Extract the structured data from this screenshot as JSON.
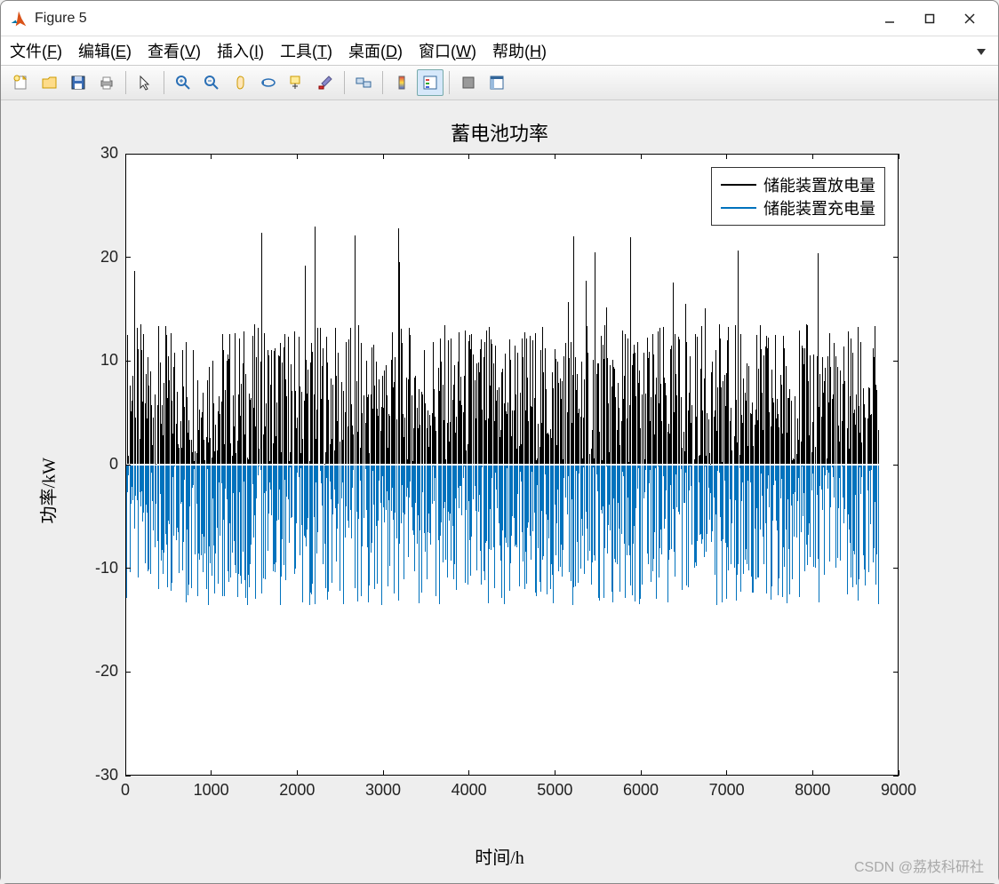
{
  "window": {
    "title": "Figure 5"
  },
  "menu": {
    "file": "文件(F)",
    "edit": "编辑(E)",
    "view": "查看(V)",
    "insert": "插入(I)",
    "tools": "工具(T)",
    "desktop": "桌面(D)",
    "window": "窗口(W)",
    "help": "帮助(H)"
  },
  "chart_data": {
    "type": "bar",
    "title": "蓄电池功率",
    "xlabel": "时间/h",
    "ylabel": "功率/kW",
    "xlim": [
      0,
      9000
    ],
    "ylim": [
      -30,
      30
    ],
    "xticks": [
      0,
      1000,
      2000,
      3000,
      4000,
      5000,
      6000,
      7000,
      8000,
      9000
    ],
    "yticks": [
      -30,
      -20,
      -10,
      0,
      10,
      20,
      30
    ],
    "x_range_data": [
      0,
      8760
    ],
    "series": [
      {
        "name": "储能装置放电量",
        "color": "#000000",
        "typical_range": [
          0,
          13.5
        ],
        "peaks_observed": [
          19,
          20,
          20.5,
          22,
          22.5
        ],
        "note": "Dense hourly bars; majority cluster 0–13.5 kW with sparse spikes up to ~22.5 kW"
      },
      {
        "name": "储能装置充电量",
        "color": "#0072BD",
        "typical_range": [
          -13.5,
          0
        ],
        "troughs_observed": [
          -13.5
        ],
        "note": "Dense hourly bars; mostly between 0 and −13.5 kW"
      }
    ],
    "legend": {
      "position": "upper-right",
      "entries": [
        "储能装置放电量",
        "储能装置充电量"
      ]
    },
    "grid": false
  },
  "watermark": "CSDN @荔枝科研社"
}
